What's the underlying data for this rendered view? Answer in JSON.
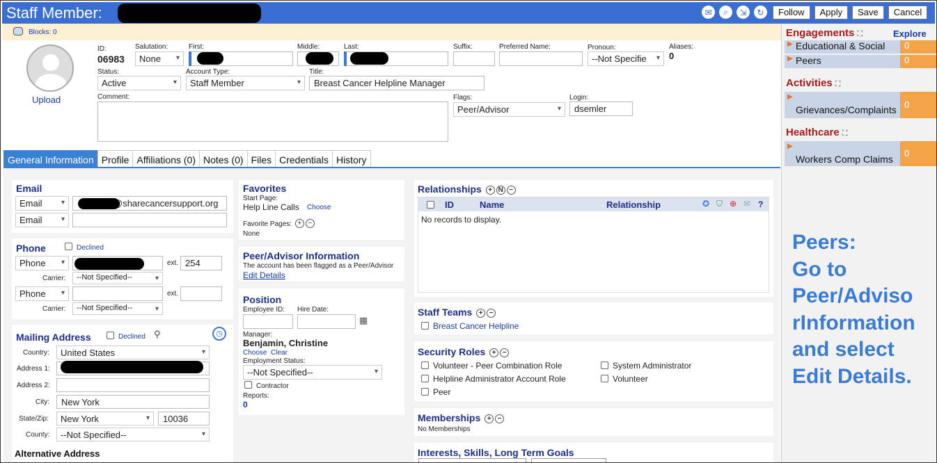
{
  "header": {
    "title": "Staff Member:",
    "buttons": [
      "Follow",
      "Apply",
      "Save",
      "Cancel"
    ],
    "icons": [
      "chat-icon",
      "search-icon",
      "export-icon",
      "refresh-icon"
    ]
  },
  "blocks": {
    "label": "Blocks: 0"
  },
  "profile": {
    "upload_label": "Upload",
    "id_label": "ID:",
    "id_value": "06983",
    "salutation_label": "Salutation:",
    "salutation_value": "None",
    "first_label": "First:",
    "middle_label": "Middle:",
    "last_label": "Last:",
    "suffix_label": "Suffix:",
    "preferred_label": "Preferred Name:",
    "pronoun_label": "Pronoun:",
    "pronoun_value": "--Not Specifie",
    "aliases_label": "Aliases:",
    "aliases_value": "0",
    "status_label": "Status:",
    "status_value": "Active",
    "account_type_label": "Account Type:",
    "account_type_value": "Staff Member",
    "title_label": "Title:",
    "title_value": "Breast Cancer Helpline Manager",
    "comment_label": "Comment:",
    "flags_label": "Flags:",
    "flags_value": "Peer/Advisor",
    "login_label": "Login:",
    "login_value": "dsemler"
  },
  "tabs": [
    {
      "label": "General Information",
      "active": true
    },
    {
      "label": "Profile"
    },
    {
      "label": "Affiliations (0)"
    },
    {
      "label": "Notes (0)"
    },
    {
      "label": "Files"
    },
    {
      "label": "Credentials"
    },
    {
      "label": "History"
    }
  ],
  "email": {
    "title": "Email",
    "rows": [
      {
        "type": "Email",
        "value": "@sharecancersupport.org"
      },
      {
        "type": "Email",
        "value": ""
      }
    ]
  },
  "phone": {
    "title": "Phone",
    "declined": "Declined",
    "ext_label": "ext.",
    "carrier_label": "Carrier:",
    "rows": [
      {
        "type": "Phone",
        "ext": "254",
        "carrier": "--Not Specified--"
      },
      {
        "type": "Phone",
        "ext": "",
        "carrier": "--Not Specified--"
      }
    ]
  },
  "mailing": {
    "title": "Mailing Address",
    "declined": "Declined",
    "country_label": "Country:",
    "country": "United States",
    "address1_label": "Address 1:",
    "address2_label": "Address 2:",
    "city_label": "City:",
    "city": "New York",
    "statezip_label": "State/Zip:",
    "state": "New York",
    "zip": "10036",
    "county_label": "County:",
    "county": "--Not Specified--",
    "alt_title": "Alternative Address"
  },
  "favorites": {
    "title": "Favorites",
    "start_label": "Start Page:",
    "start_value": "Help Line Calls",
    "choose": "Choose",
    "fav_pages_label": "Favorite Pages:",
    "fav_pages_value": "None"
  },
  "peer": {
    "title": "Peer/Advisor Information",
    "text": "The account has been flagged as a Peer/Advisor",
    "link": "Edit Details"
  },
  "position": {
    "title": "Position",
    "employee_id_label": "Employee ID:",
    "hire_date_label": "Hire Date:",
    "manager_label": "Manager:",
    "manager_value": "Benjamin, Christine",
    "choose": "Choose",
    "clear": "Clear",
    "employment_status_label": "Employment Status:",
    "employment_status_value": "--Not Specified--",
    "contractor_label": "Contractor",
    "reports_label": "Reports:",
    "reports_value": "0"
  },
  "relationships": {
    "title": "Relationships",
    "columns": [
      "ID",
      "Name",
      "Relationship"
    ],
    "empty": "No records to display.",
    "help": "?"
  },
  "staff_teams": {
    "title": "Staff Teams",
    "items": [
      "Breast Cancer Helpline"
    ]
  },
  "security_roles": {
    "title": "Security Roles",
    "left": [
      "Volunteer - Peer Combination Role",
      "Helpline Administrator Account Role",
      "Peer"
    ],
    "right": [
      "System Administrator",
      "Volunteer"
    ]
  },
  "memberships": {
    "title": "Memberships",
    "empty": "No Memberships"
  },
  "interests": {
    "title": "Interests, Skills, Long Term Goals"
  },
  "sidebar": {
    "explore": "Explore",
    "sections": [
      {
        "title": "Engagements",
        "rows": [
          {
            "label": "Educational & Social",
            "count": "0"
          },
          {
            "label": "Peers",
            "count": "0"
          }
        ]
      },
      {
        "title": "Activities",
        "rows": [
          {
            "label": "Grievances/Complaints",
            "count": "0"
          }
        ]
      },
      {
        "title": "Healthcare",
        "rows": [
          {
            "label": "Workers Comp Claims",
            "count": "0"
          }
        ]
      }
    ]
  },
  "callout": {
    "lines": [
      "Peers:",
      "Go to",
      "Peer/Adviso",
      "rInformation",
      "and select",
      "Edit Details."
    ]
  },
  "colors": {
    "header": "#3a6ed2",
    "accent": "#3a80d4",
    "section_title": "#1c2e8a",
    "sidebar_head": "#a81a1a",
    "count_bg": "#f4a448",
    "callout": "#3a7bd5"
  }
}
